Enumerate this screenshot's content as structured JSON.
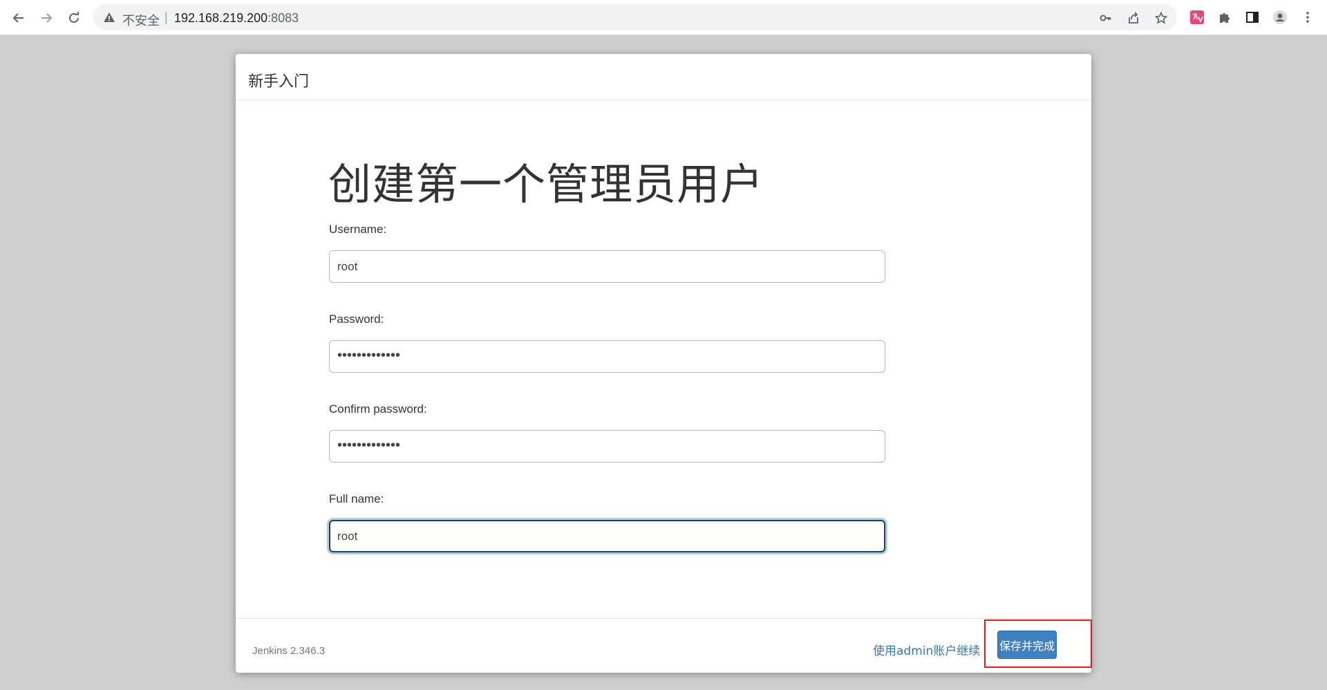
{
  "browser": {
    "insecure_label": "不安全",
    "separator": "|",
    "url_host": "192.168.219.200",
    "url_port": ":8083",
    "icons": [
      "back-icon",
      "forward-icon",
      "reload-icon",
      "warning-icon",
      "key-icon",
      "share-icon",
      "star-icon",
      "translate-icon",
      "puzzle-icon",
      "side-panel-icon",
      "profile-icon",
      "more-icon"
    ],
    "translate_ext_color": "#e8467c"
  },
  "dialog": {
    "header_title": "新手入门",
    "page_title": "创建第一个管理员用户",
    "fields": [
      {
        "label": "Username:",
        "value": "root"
      },
      {
        "label": "Password:",
        "value": "•••••••••••••"
      },
      {
        "label": "Confirm password:",
        "value": "•••••••••••••"
      },
      {
        "label": "Full name:",
        "value": "root"
      }
    ],
    "footer": {
      "version": "Jenkins 2.346.3",
      "admin_link": "使用admin账户继续",
      "save_button": "保存并完成"
    }
  },
  "colors": {
    "primary_button": "#3f80c0",
    "link": "#3a76b0",
    "highlight": "#e81818"
  }
}
